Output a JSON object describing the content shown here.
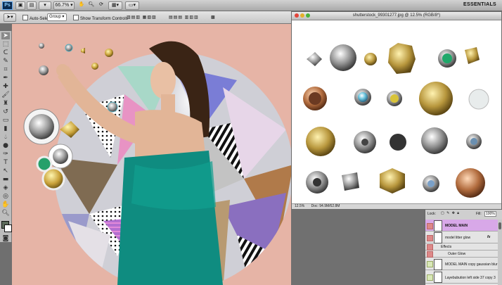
{
  "appbar": {
    "logo": "Ps",
    "zoom": "66.7%",
    "workspace": "ESSENTIALS"
  },
  "options": {
    "auto_select_label": "Auto-Select:",
    "auto_select_value": "Group",
    "show_transform_label": "Show Transform Controls"
  },
  "document": {
    "title": "shutterstock_99301277.jpg @ 12.5% (RGB/8*)",
    "status_zoom": "12.5%",
    "status_doc": "Doc: 94.9M/62.8M"
  },
  "layers_panel": {
    "lock_label": "Lock:",
    "fill_label": "Fill:",
    "fill_value": "100%",
    "rows": [
      {
        "name": "MODEL MAIN",
        "selected": true
      },
      {
        "name": "model litter glow",
        "fx": "fx"
      },
      {
        "name": "Effects",
        "sub": true
      },
      {
        "name": "Outer Glow",
        "sub": true
      },
      {
        "name": "MODEL MAIN copy gaussian blur"
      },
      {
        "name": "Layebubution left side 37 copy 3"
      }
    ]
  },
  "colors": {
    "canvas_bg": "#e6b4a6",
    "dress": "#0f8c80",
    "selected_layer": "#d8a8e8"
  }
}
